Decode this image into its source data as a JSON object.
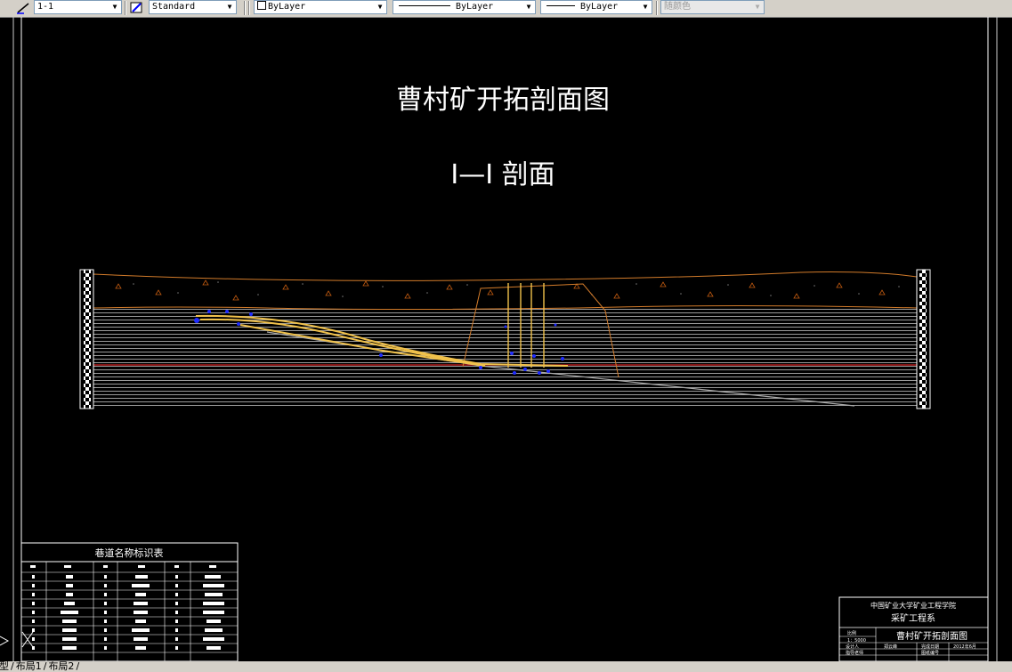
{
  "toolbar": {
    "dimstyle": "1-1",
    "textstyle": "Standard",
    "layer": "ByLayer",
    "linetype": "ByLayer",
    "lineweight": "ByLayer",
    "plotstyle": "随颜色"
  },
  "drawing": {
    "title": "曹村矿开拓剖面图",
    "subtitle": "I—I 剖面"
  },
  "legend": {
    "title": "巷道名称标识表"
  },
  "titleblock": {
    "school": "中国矿业大学矿业工程学院",
    "dept": "采矿工程系",
    "drawing_name": "曹村矿开拓剖面图",
    "scale_label": "比例",
    "scale": "1：5000",
    "designer_label": "设计人",
    "designer": "郑云峰",
    "checker_label": "指导老师",
    "checker": "",
    "date_label": "完成日期",
    "date": "2012年6月",
    "page_label": "图纸编号",
    "page": ""
  },
  "tabs": [
    "模型",
    "布局1",
    "布局2"
  ],
  "colors": {
    "background": "#000000",
    "strata": "#ffffff",
    "surface": "#d27b2a",
    "roadway": "#f0c14b",
    "marker": "#1f2cff",
    "coal_seam": "#d42020"
  }
}
